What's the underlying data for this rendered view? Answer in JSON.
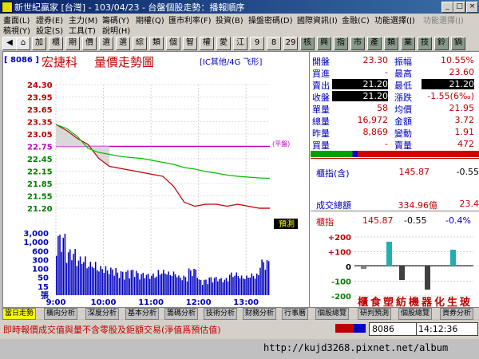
{
  "window": {
    "title": "新世紀贏家 [台灣] - 103/04/23 - 台盤個股走勢：播報順序"
  },
  "menu1": [
    "畫面(L)",
    "證券(E)",
    "主力(M)",
    "籌碼(Y)",
    "期權(Q)",
    "匯市利率(F)",
    "投資(B)",
    "操盤密碼(D)",
    "國際資訊(I)",
    "金融(C)",
    "功能選擇(J)",
    "功能選擇(J)"
  ],
  "menu2": [
    "稿視(Y)",
    "設定(S)",
    "工具(T)",
    "說明(H)"
  ],
  "toolbar": [
    "加",
    "櫃",
    "期",
    "價",
    "選",
    "選",
    "綜",
    "類",
    "個",
    "智",
    "權",
    "愛",
    "江",
    "9",
    "8",
    "29",
    "核",
    "興",
    "指",
    "市",
    "產",
    "類",
    "業",
    "技",
    "鈴",
    "鍋"
  ],
  "stock": {
    "code": "[ 8086 ]",
    "name": "宏捷科",
    "title": "量價走勢圖",
    "sub": "[IC其他/4G 飞形]"
  },
  "price_axis": [
    "24.30",
    "23.95",
    "23.65",
    "23.35",
    "23.05",
    "22.75",
    "22.45",
    "22.15",
    "21.85",
    "21.55",
    "21.20"
  ],
  "volume_axis": [
    "3,000",
    "1,000",
    "600",
    "300",
    "100",
    "50",
    "15",
    "張"
  ],
  "time_axis": [
    "9:00",
    "10:00",
    "11:00",
    "12:00",
    "13:00"
  ],
  "ref_label": "(平盤)",
  "yuce_label": "預測",
  "quote": {
    "rows": [
      {
        "l": "開盤",
        "v": "23.30",
        "r": "振幅",
        "x": "10.55%"
      },
      {
        "l": "買進",
        "v": "-",
        "r": "最高",
        "x": "23.60"
      },
      {
        "l": "賣出",
        "v": "21.20",
        "r": "最低",
        "x": "21.20"
      },
      {
        "l": "收盤",
        "v": "21.20",
        "r": "漲跌",
        "x": "-1.55(6‰)"
      },
      {
        "l": "單量",
        "v": "58",
        "r": "均價",
        "x": "21.95"
      },
      {
        "l": "總量",
        "v": "16,972",
        "r": "金額",
        "x": "3.72"
      },
      {
        "l": "昨量",
        "v": "8,869",
        "r": "變動",
        "x": "1.91"
      },
      {
        "l": "買量",
        "v": "-",
        "r": "賣量",
        "x": "472"
      }
    ],
    "index_label": "櫃指(含)",
    "index_value": "145.87",
    "index_change": "-0.55",
    "turnover_label": "成交總額",
    "turnover_value": "334.96億",
    "turnover_extra": "23.4"
  },
  "sector": {
    "label": "櫃指",
    "value": "145.87",
    "change": "-0.55",
    "pct": "-0.4%",
    "axis": [
      "+200",
      "+100",
      "0",
      "-100",
      "-200"
    ],
    "categories": [
      "櫃",
      "食",
      "塑",
      "紡",
      "機",
      "器",
      "化",
      "生",
      "玻"
    ]
  },
  "tabs": [
    "當日走勢",
    "橫向分析",
    "深度分析",
    "基本分析",
    "籌碼分析",
    "技術分析",
    "財務分析",
    "行事曆",
    "個股總覽",
    "研判預測",
    "個股總覽",
    "資券分析"
  ],
  "status": {
    "marquee": "即時報價成交值與量不含零股及鉅額交易(淨值爲預估值)",
    "code": "8086",
    "time": "14:12:36"
  },
  "url": "http://kujd3268.pixnet.net/album",
  "chart_data": {
    "type": "line",
    "x": [
      "9:00",
      "9:10",
      "9:20",
      "9:30",
      "9:40",
      "9:50",
      "10:00",
      "10:15",
      "10:30",
      "10:45",
      "11:00",
      "11:15",
      "11:30",
      "11:45",
      "12:00",
      "12:15",
      "12:30",
      "12:45",
      "13:00",
      "13:15",
      "13:30"
    ],
    "series": [
      {
        "values": [
          23.3,
          23.15,
          22.95,
          22.8,
          22.45,
          22.25,
          22.2,
          22.15,
          22.1,
          22.05,
          22.0,
          21.75,
          21.35,
          21.25,
          21.3,
          21.3,
          21.25,
          21.3,
          21.25,
          21.2,
          21.2
        ]
      },
      {
        "values": [
          23.3,
          23.2,
          23.0,
          22.7,
          22.6,
          22.55,
          22.5,
          22.47,
          22.45,
          22.4,
          22.35,
          22.3,
          22.22,
          22.18,
          22.12,
          22.08,
          22.03,
          22.0,
          21.98,
          21.96,
          21.95
        ]
      }
    ],
    "reference": 22.75,
    "ylim": [
      21.2,
      24.3
    ],
    "volume": [
      900,
      500,
      350,
      260,
      200,
      180,
      140,
      160,
      120,
      110,
      150,
      130,
      90,
      170,
      60,
      80,
      70,
      120,
      90,
      110,
      300
    ],
    "colors": {
      "price": "#c00000",
      "avg": "#00c000",
      "ref": "#c000c0",
      "volume": "#0000c0"
    }
  }
}
